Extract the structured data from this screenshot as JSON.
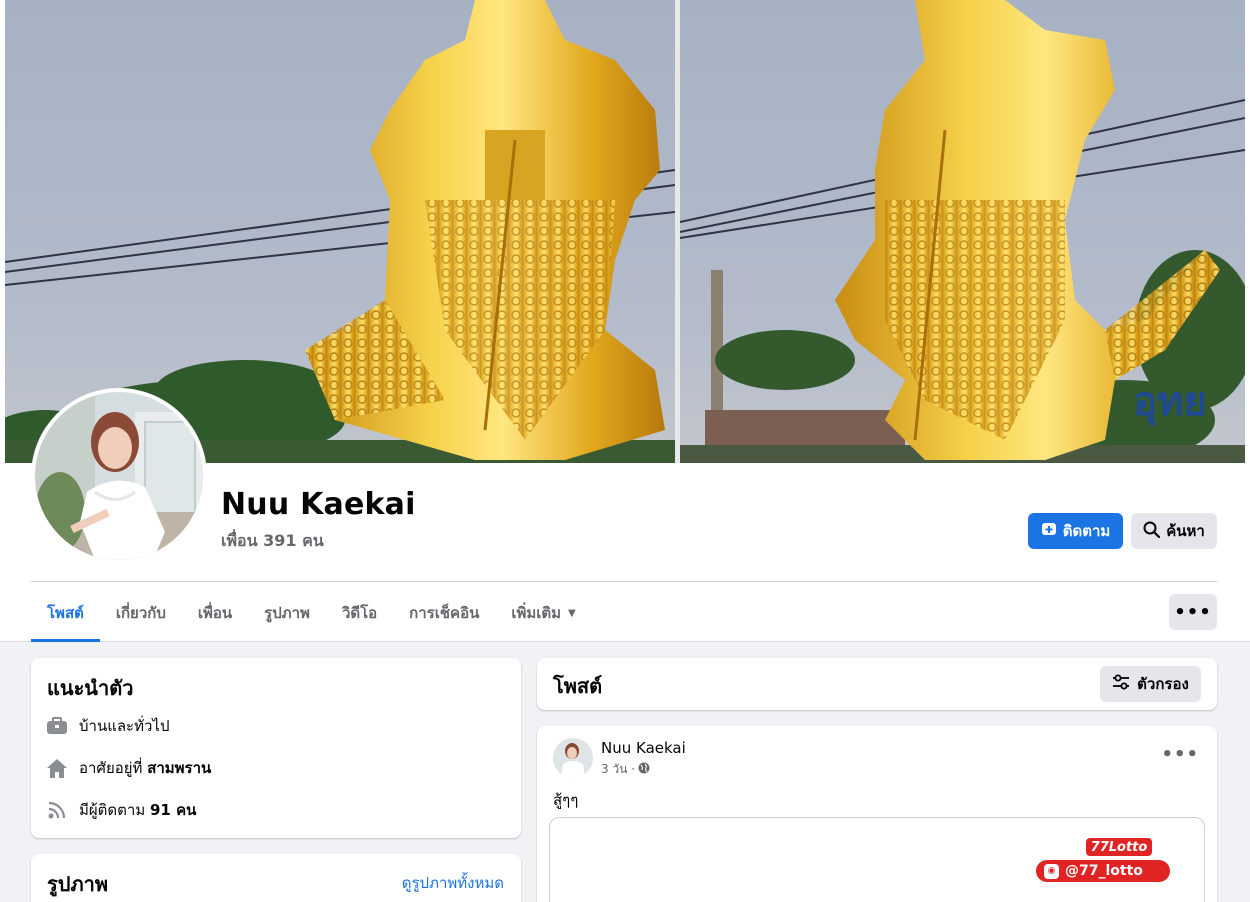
{
  "colors": {
    "accent": "#1b74e4",
    "page_bg": "#f0f2f5",
    "secondary_button_bg": "#e4e6eb",
    "secondary_text": "#65676b",
    "lotto_red": "#e02323"
  },
  "profile": {
    "name": "Nuu Kaekai",
    "friends": "เพื่อน 391 คน",
    "follow_label": "ติดตาม",
    "search_label": "ค้นหา"
  },
  "tabs": [
    {
      "label": "โพสต์",
      "active": true
    },
    {
      "label": "เกี่ยวกับ",
      "active": false
    },
    {
      "label": "เพื่อน",
      "active": false
    },
    {
      "label": "รูปภาพ",
      "active": false
    },
    {
      "label": "วิดีโอ",
      "active": false
    },
    {
      "label": "การเช็คอิน",
      "active": false
    },
    {
      "label": "เพิ่มเติม",
      "active": false
    }
  ],
  "more_menu": "•••",
  "intro": {
    "title": "แนะนำตัว",
    "rows": [
      {
        "icon": "briefcase-icon",
        "text": "บ้านและทั่วไป",
        "bold": ""
      },
      {
        "icon": "home-icon",
        "text": "อาศัยอยู่ที่ ",
        "bold": "สามพราน"
      },
      {
        "icon": "rss-icon",
        "text": "มีผู้ติดตาม ",
        "bold": "91 คน"
      }
    ]
  },
  "photos": {
    "title": "รูปภาพ",
    "see_all": "ดูรูปภาพทั้งหมด"
  },
  "posts_section": {
    "title": "โพสต์",
    "filter_label": "ตัวกรอง"
  },
  "post": {
    "author": "Nuu Kaekai",
    "time": "3 วัน ·",
    "privacy_icon": "globe-icon",
    "text": "สู้ๆๆ",
    "menu": "•••",
    "media_logo_top": "77Lotto",
    "media_logo_handle": "@77_lotto"
  }
}
